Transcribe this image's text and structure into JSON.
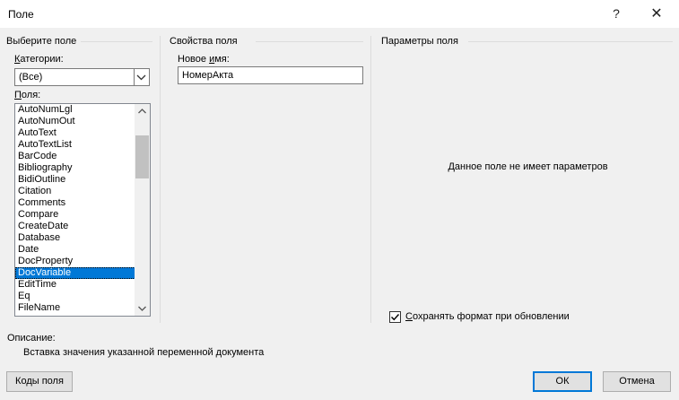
{
  "window": {
    "title": "Поле",
    "help_glyph": "?",
    "close_glyph": "✕"
  },
  "left_group": {
    "title": "Выберите поле",
    "categories_label": "Категории:",
    "categories_value": "(Все)",
    "fields_label": "Поля:",
    "fields": [
      "AutoNumLgl",
      "AutoNumOut",
      "AutoText",
      "AutoTextList",
      "BarCode",
      "Bibliography",
      "BidiOutline",
      "Citation",
      "Comments",
      "Compare",
      "CreateDate",
      "Database",
      "Date",
      "DocProperty",
      "DocVariable",
      "EditTime",
      "Eq",
      "FileName"
    ],
    "selected_field": "DocVariable"
  },
  "middle_group": {
    "title": "Свойства поля",
    "new_name_label": "Новое имя:",
    "new_name_value": "НомерАкта"
  },
  "right_group": {
    "title": "Параметры поля",
    "no_params_text": "Данное поле не имеет параметров",
    "preserve_format_label": "Сохранять формат при обновлении",
    "preserve_format_checked": true
  },
  "description": {
    "label": "Описание:",
    "text": "Вставка значения указанной переменной документа"
  },
  "buttons": {
    "field_codes": "Коды поля",
    "ok": "ОК",
    "cancel": "Отмена"
  },
  "colors": {
    "selection": "#0078d7",
    "dialog_bg": "#f0f0f0"
  }
}
